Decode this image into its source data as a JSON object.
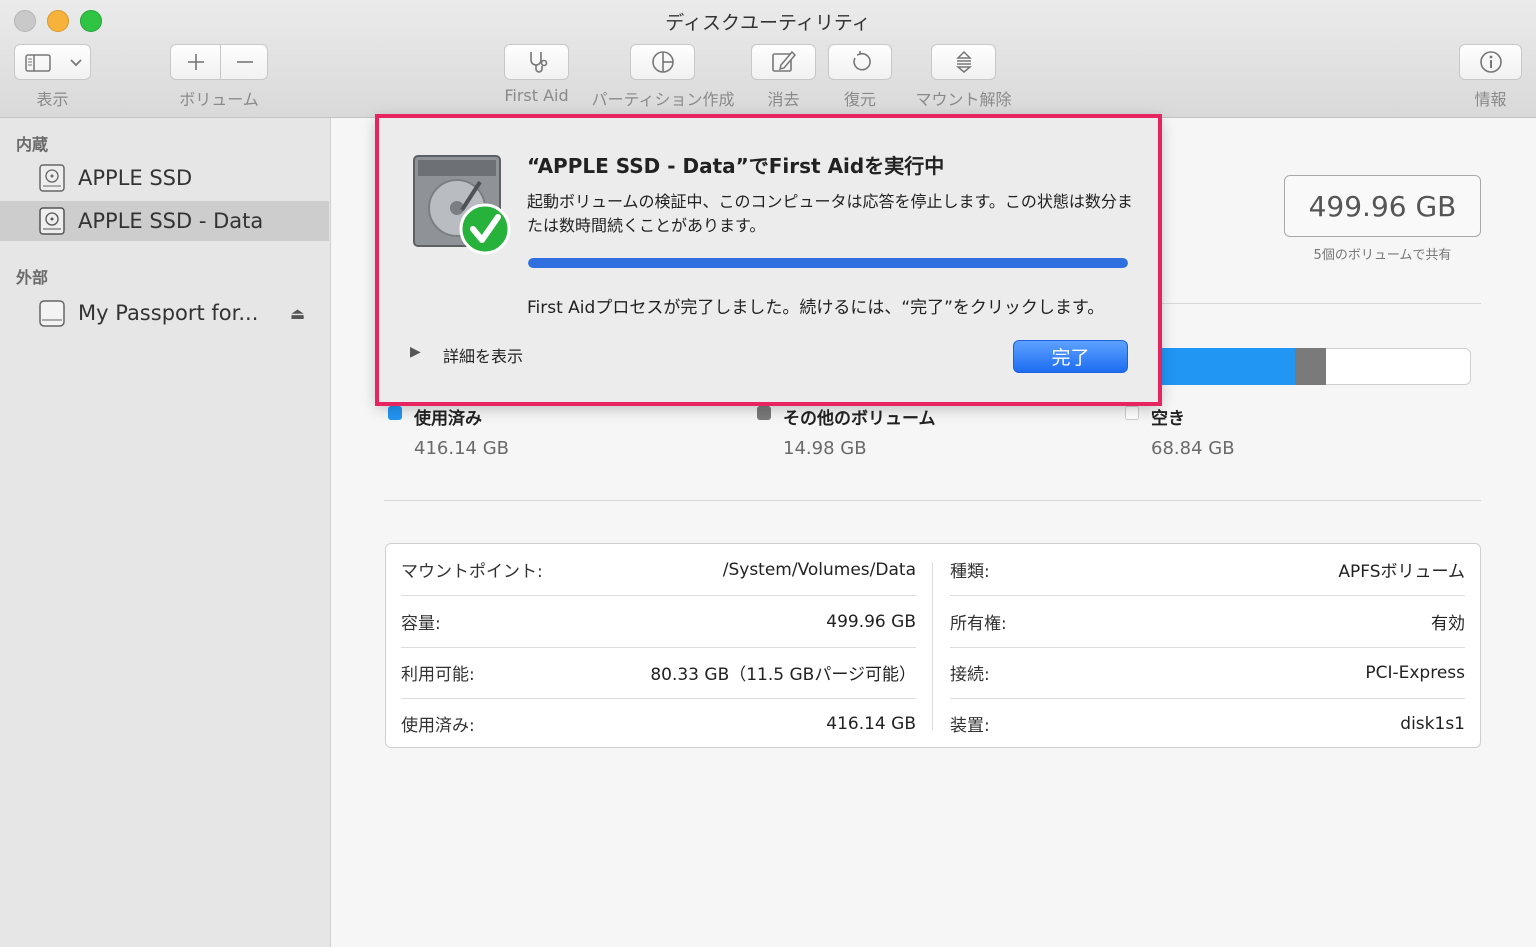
{
  "window": {
    "title": "ディスクユーティリティ"
  },
  "toolbar": {
    "view_label": "表示",
    "volume_label": "ボリューム",
    "firstaid_label": "First Aid",
    "partition_label": "パーティション作成",
    "erase_label": "消去",
    "restore_label": "復元",
    "unmount_label": "マウント解除",
    "info_label": "情報"
  },
  "sidebar": {
    "internal_header": "内蔵",
    "external_header": "外部",
    "items": [
      {
        "label": "APPLE SSD",
        "selected": false
      },
      {
        "label": "APPLE SSD - Data",
        "selected": true
      },
      {
        "label": "My Passport for..."
      }
    ]
  },
  "summary": {
    "capacity": "499.96 GB",
    "shared_note": "5個のボリュームで共有"
  },
  "usage": {
    "used": {
      "label": "使用済み",
      "value": "416.14 GB",
      "color": "#2196f3"
    },
    "other": {
      "label": "その他のボリューム",
      "value": "14.98 GB",
      "color": "#7a7a7a"
    },
    "free": {
      "label": "空き",
      "value": "68.84 GB",
      "color": "#ffffff"
    }
  },
  "info": {
    "left": [
      {
        "key": "マウントポイント:",
        "value": "/System/Volumes/Data"
      },
      {
        "key": "容量:",
        "value": "499.96 GB"
      },
      {
        "key": "利用可能:",
        "value": "80.33 GB（11.5 GBパージ可能）"
      },
      {
        "key": "使用済み:",
        "value": "416.14 GB"
      }
    ],
    "right": [
      {
        "key": "種類:",
        "value": "APFSボリューム"
      },
      {
        "key": "所有権:",
        "value": "有効"
      },
      {
        "key": "接続:",
        "value": "PCI-Express"
      },
      {
        "key": "装置:",
        "value": "disk1s1"
      }
    ]
  },
  "dialog": {
    "title": "“APPLE SSD - Data”でFirst Aidを実行中",
    "message": "起動ボリュームの検証中、このコンピュータは応答を停止します。この状態は数分または数時間続くことがあります。",
    "progress": 1.0,
    "status": "First Aidプロセスが完了しました。続けるには、“完了”をクリックします。",
    "details_label": "詳細を表示",
    "done_label": "完了",
    "highlight_color": "#e6245f"
  }
}
